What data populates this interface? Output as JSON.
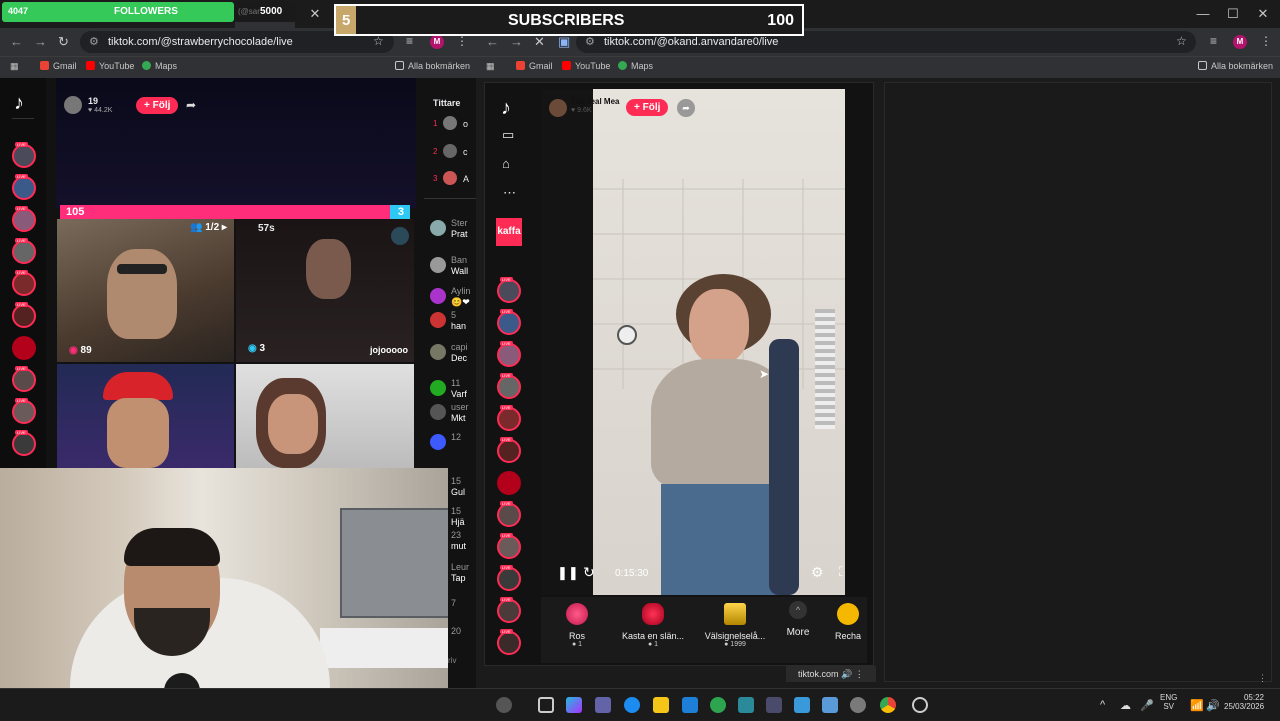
{
  "overlay": {
    "followers_current": "4047",
    "followers_label": "FOLLOWERS",
    "followers_goal": "5000",
    "followers_user_fragment": "(@sar",
    "subs_current": "5",
    "subs_label": "SUBSCRIBERS",
    "subs_goal": "100"
  },
  "left_browser": {
    "url": "tiktok.com/@strawberrychocolade/live",
    "bookmarks": [
      "Gmail",
      "YouTube",
      "Maps"
    ],
    "all_bookmarks": "Alla bokmärken",
    "viewer_count": "19",
    "likes": "44.2K",
    "follow_label": "+ Följ",
    "battle_left": "105",
    "battle_right": "3",
    "guest_count": "1/2",
    "timer": "57s",
    "tile1_score": "89",
    "tile2_score": "3",
    "tile2_name": "jojooooo",
    "viewers_header": "Tittare",
    "top_viewers": [
      {
        "rank": "1",
        "name": "o"
      },
      {
        "rank": "2",
        "name": "c"
      },
      {
        "rank": "3",
        "name": "A"
      }
    ],
    "chat": [
      {
        "name": "Ster",
        "text": "Prat"
      },
      {
        "name": "Ban",
        "text": "Wall"
      },
      {
        "name": "Aylin",
        "text": "😊❤"
      },
      {
        "name": "5",
        "text": "han"
      },
      {
        "name": "capi",
        "text": "Dec"
      },
      {
        "name": "11",
        "text": "Varf"
      },
      {
        "name": "user",
        "text": "Mkt"
      },
      {
        "name": "12",
        "text": ""
      },
      {
        "name": "15",
        "text": "Gul"
      },
      {
        "name": "15",
        "text": "Hjä"
      },
      {
        "name": "23",
        "text": "mut"
      },
      {
        "name": "Leur",
        "text": "Tap"
      },
      {
        "name": "7",
        "text": ""
      },
      {
        "name": "20",
        "text": ""
      }
    ],
    "chat_input_fragment": "riv"
  },
  "right_browser": {
    "url": "tiktok.com/@okand.anvandare0/live",
    "bookmarks": [
      "Gmail",
      "YouTube",
      "Maps"
    ],
    "all_bookmarks": "Alla bokmärken",
    "streamer_name": "The real Mea",
    "streamer_likes": "9.6K",
    "follow_label": "+ Följ",
    "sidebar_label": "kaffa",
    "elapsed": "0:15:30",
    "gifts": [
      {
        "name": "Ros",
        "coins": "1"
      },
      {
        "name": "Kasta en slän...",
        "coins": "1"
      },
      {
        "name": "Välsignelselå...",
        "coins": "1999"
      }
    ],
    "more_label": "More",
    "recharge_fragment": "Recha",
    "tab_audio_label": "tiktok.com"
  },
  "taskbar": {
    "lang": "ENG",
    "lang_sub": "SV",
    "time": "05:22",
    "date": "25/03/2026"
  },
  "colors": {
    "tiktok_red": "#fe2c55",
    "followers_green": "#35c95a",
    "battle_pink": "#ff2d7a",
    "battle_blue": "#2ec8f5"
  }
}
